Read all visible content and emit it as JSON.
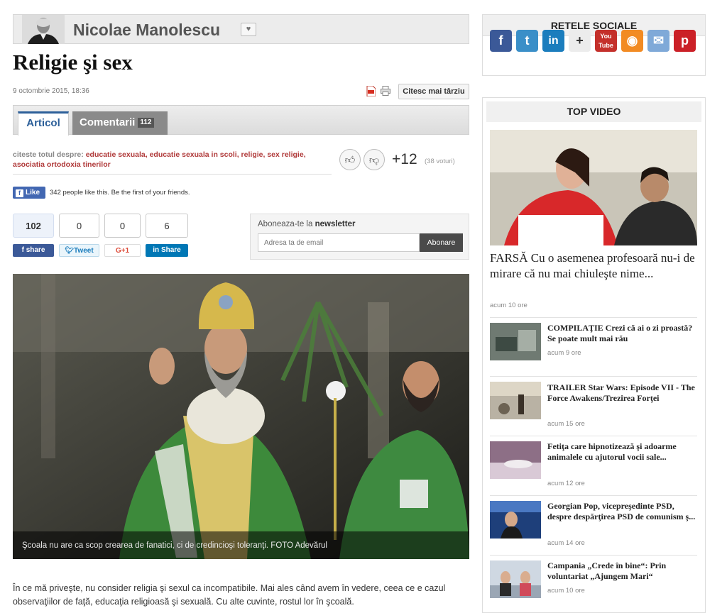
{
  "author": {
    "name": "Nicolae Manolescu",
    "heart": "♥"
  },
  "article": {
    "title": "Religie şi sex",
    "date": "9 octombrie 2015, 18:36",
    "later_label": "Citesc mai târziu",
    "tabs": [
      {
        "label": "Articol"
      },
      {
        "label": "Comentarii",
        "count": "112"
      }
    ],
    "tags_label": "citeste totul despre:",
    "tags": "educatie sexuala, educatie sexuala in scoli, religie, sex religie, asociatia ortodoxia tinerilor",
    "vote_score": "+12",
    "vote_count": "(38 voturi)",
    "caption": "Şcoala nu are ca scop crearea de fanatici, ci de credincioşi toleranţi. FOTO Adevărul",
    "body": "În ce mă priveşte, nu consider religia şi sexul ca incompatibile. Mai ales când avem în vedere, ceea ce e cazul observaţiilor de faţă, educaţia religioasă şi sexuală. Cu alte cuvinte, rostul lor în şcoală."
  },
  "facebook": {
    "like_label": "Like",
    "text": "342 people like this. Be the first of your friends."
  },
  "shares": {
    "facebook": {
      "count": "102",
      "label": "share"
    },
    "twitter": {
      "count": "0",
      "label": "Tweet"
    },
    "google": {
      "count": "0",
      "label": "G+1"
    },
    "linkedin": {
      "count": "6",
      "label": "Share"
    }
  },
  "newsletter": {
    "label_prefix": "Aboneaza-te la",
    "label_bold": "newsletter",
    "placeholder": "Adresa ta de email",
    "button": "Abonare"
  },
  "sidebar": {
    "social_title": "RETELE SOCIALE",
    "social_icons": [
      "facebook-icon",
      "twitter-icon",
      "linkedin-icon",
      "google-plus-icon",
      "youtube-icon",
      "rss-icon",
      "email-icon",
      "pinterest-icon"
    ],
    "video_title": "TOP VIDEO",
    "main_video": {
      "title": "FARSĂ Cu o asemenea profesoară nu-i de mirare că nu mai chiuleşte nime...",
      "time": "acum 10 ore"
    },
    "videos": [
      {
        "title": "COMPILAŢIE Crezi că ai o zi proastă? Se poate mult mai rău",
        "time": "acum 9 ore"
      },
      {
        "title": "TRAILER Star Wars: Episode VII - The Force Awakens/Trezirea Forţei",
        "time": "acum 15 ore"
      },
      {
        "title": "Fetiţa care hipnotizează şi adoarme animalele cu ajutorul vocii sale...",
        "time": "acum 12 ore"
      },
      {
        "title": "Georgian Pop, vicepreşedinte PSD, despre despărţirea PSD de comunism ş...",
        "time": "acum 14 ore"
      },
      {
        "title": "Campania „Crede în bine“: Prin voluntariat „Ajungem Mari“",
        "time": "acum 10 ore"
      }
    ]
  }
}
